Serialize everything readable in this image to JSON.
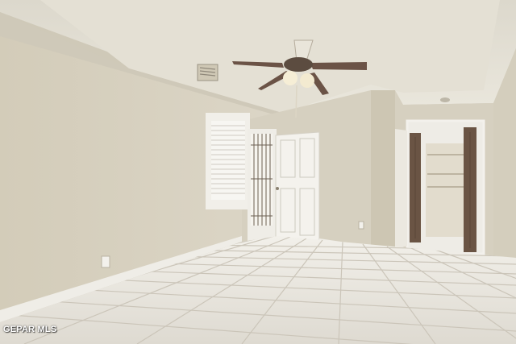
{
  "watermark": {
    "text": "GEPAR MLS"
  },
  "palette": {
    "wall": "#d9d3c3",
    "wall_shadow": "#c8c1ae",
    "ceiling": "#e6e2d6",
    "floor": "#e9e6df",
    "grout": "#c9c4b9",
    "door": "#f3f1ec",
    "trim": "#f1efe9",
    "closet_door": "#6a5444",
    "fan_blade": "#6b5346"
  }
}
